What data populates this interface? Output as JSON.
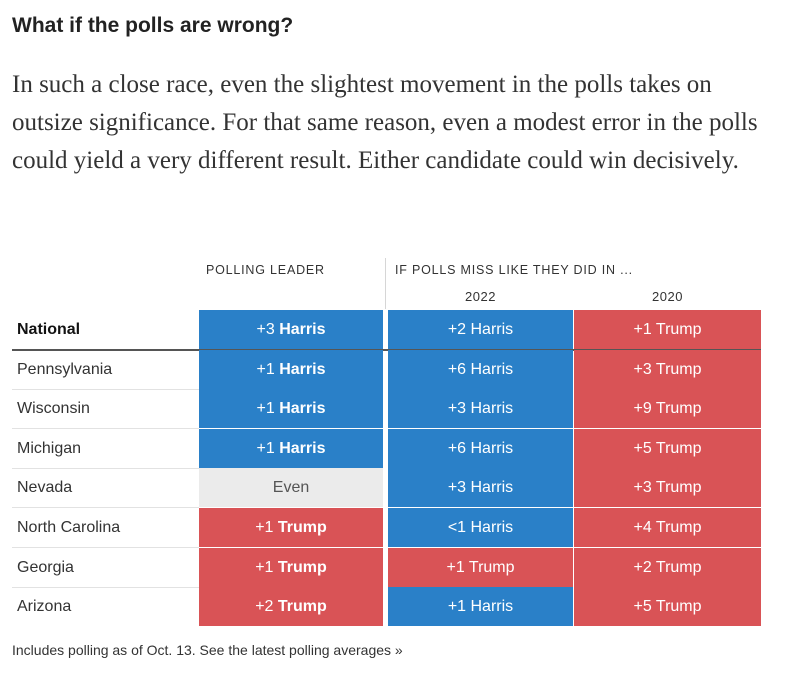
{
  "headline": "What if the polls are wrong?",
  "intro": "In such a close race, even the slightest movement in the polls takes on outsize significance. For that same reason, even a modest error in the polls could yield a very different result. Either candidate could win decisively.",
  "footnote": {
    "text": "Includes polling as of Oct. 13. See the ",
    "link": "latest polling averages »"
  },
  "colors": {
    "harris": "#2a80c8",
    "trump": "#d95356",
    "even": "#ebebeb"
  },
  "chart_data": {
    "type": "table",
    "column_headers": {
      "leader": "POLLING LEADER",
      "miss_group": "IF POLLS MISS LIKE THEY DID IN ...",
      "y2022": "2022",
      "y2020": "2020"
    },
    "rows": [
      {
        "state": "National",
        "leader": {
          "margin": "+3",
          "name": "Harris",
          "party": "harris"
        },
        "y2022": {
          "text": "+2 Harris",
          "party": "harris"
        },
        "y2020": {
          "text": "+1 Trump",
          "party": "trump"
        }
      },
      {
        "state": "Pennsylvania",
        "leader": {
          "margin": "+1",
          "name": "Harris",
          "party": "harris"
        },
        "y2022": {
          "text": "+6 Harris",
          "party": "harris"
        },
        "y2020": {
          "text": "+3 Trump",
          "party": "trump"
        }
      },
      {
        "state": "Wisconsin",
        "leader": {
          "margin": "+1",
          "name": "Harris",
          "party": "harris"
        },
        "y2022": {
          "text": "+3 Harris",
          "party": "harris"
        },
        "y2020": {
          "text": "+9 Trump",
          "party": "trump"
        }
      },
      {
        "state": "Michigan",
        "leader": {
          "margin": "+1",
          "name": "Harris",
          "party": "harris"
        },
        "y2022": {
          "text": "+6 Harris",
          "party": "harris"
        },
        "y2020": {
          "text": "+5 Trump",
          "party": "trump"
        }
      },
      {
        "state": "Nevada",
        "leader": {
          "margin": "",
          "name": "Even",
          "party": "even"
        },
        "y2022": {
          "text": "+3 Harris",
          "party": "harris"
        },
        "y2020": {
          "text": "+3 Trump",
          "party": "trump"
        }
      },
      {
        "state": "North Carolina",
        "leader": {
          "margin": "+1",
          "name": "Trump",
          "party": "trump"
        },
        "y2022": {
          "text": "<1 Harris",
          "party": "harris"
        },
        "y2020": {
          "text": "+4 Trump",
          "party": "trump"
        }
      },
      {
        "state": "Georgia",
        "leader": {
          "margin": "+1",
          "name": "Trump",
          "party": "trump"
        },
        "y2022": {
          "text": "+1 Trump",
          "party": "trump"
        },
        "y2020": {
          "text": "+2 Trump",
          "party": "trump"
        }
      },
      {
        "state": "Arizona",
        "leader": {
          "margin": "+2",
          "name": "Trump",
          "party": "trump"
        },
        "y2022": {
          "text": "+1 Harris",
          "party": "harris"
        },
        "y2020": {
          "text": "+5 Trump",
          "party": "trump"
        }
      }
    ]
  }
}
